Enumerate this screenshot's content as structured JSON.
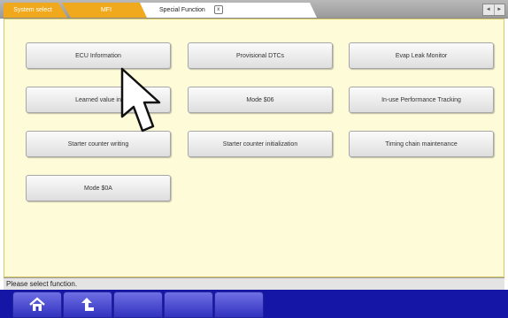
{
  "tabs": [
    {
      "label": "System select"
    },
    {
      "label": "MFI"
    },
    {
      "label": "Special Function",
      "close_icon": "close-icon"
    }
  ],
  "tab_close_glyph": "x",
  "nav_arrows": {
    "left": "◄",
    "right": "►"
  },
  "functions": [
    {
      "label": "ECU Information"
    },
    {
      "label": "Provisional DTCs"
    },
    {
      "label": "Evap Leak Monitor"
    },
    {
      "label": "Learned value in"
    },
    {
      "label": "Mode $06"
    },
    {
      "label": "In-use Performance Tracking"
    },
    {
      "label": "Starter counter writing"
    },
    {
      "label": "Starter counter initialization"
    },
    {
      "label": "Timing chain maintenance"
    },
    {
      "label": "Mode $0A"
    }
  ],
  "status": "Please select function.",
  "bottom_buttons": [
    {
      "icon": "home-icon"
    },
    {
      "icon": "back-arrow-icon"
    },
    {
      "icon": ""
    },
    {
      "icon": ""
    },
    {
      "icon": ""
    }
  ],
  "colors": {
    "tab_orange": "#f0a81c",
    "content_bg": "#fefbd9",
    "bottom_bar": "#1616a6",
    "bottom_button": "#5556d8"
  }
}
